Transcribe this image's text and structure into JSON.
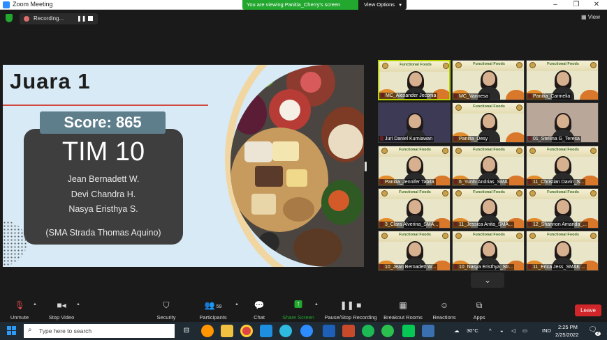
{
  "window": {
    "title": "Zoom Meeting"
  },
  "banner": {
    "text": "You are viewing Panitia_Cherry's screen",
    "options_label": "View Options"
  },
  "recording": {
    "label": "Recording..."
  },
  "view_label": "View",
  "slide": {
    "title": "Juara 1",
    "score": "Score: 865",
    "team": "TIM 10",
    "members": [
      "Jean Bernadett W.",
      "Devi Chandra H.",
      "Nasya Eristhya S."
    ],
    "school": "(SMA Strada Thomas Aquino)"
  },
  "tile_banner": "Functional Foods",
  "participants": [
    {
      "name": "MC_Alexander Jeconia",
      "style": "active"
    },
    {
      "name": "MC_Vannesa",
      "style": "std"
    },
    {
      "name": "Panitia_Carmelia",
      "style": "std"
    },
    {
      "name": "Juri Daniel Kurniawan",
      "style": "dark"
    },
    {
      "name": "Panitia_Desy",
      "style": "std"
    },
    {
      "name": "01_Stellina G_Teresa",
      "style": "room"
    },
    {
      "name": "Panitia_Jennifer Tabita",
      "style": "std"
    },
    {
      "name": "6_Yunhi Andrias_SMA",
      "style": "std"
    },
    {
      "name": "11_Christian Davin_S...",
      "style": "std"
    },
    {
      "name": "3_Clara Alverina_SMA...",
      "style": "std"
    },
    {
      "name": "11_Jessica Anita_SMA...",
      "style": "std"
    },
    {
      "name": "12_Shannon Amanda_...",
      "style": "std"
    },
    {
      "name": "10_Jean Bernadett W...",
      "style": "std"
    },
    {
      "name": "10_Nasya Eristhya_Str...",
      "style": "std"
    },
    {
      "name": "11_Erica Jess_SMAK ...",
      "style": "std"
    }
  ],
  "toolbar": {
    "unmute": "Unmute",
    "stop_video": "Stop Video",
    "security": "Security",
    "participants": "Participants",
    "participants_count": "59",
    "chat": "Chat",
    "share_screen": "Share Screen",
    "record": "Pause/Stop Recording",
    "breakout": "Breakout Rooms",
    "reactions": "Reactions",
    "apps": "Apps",
    "leave": "Leave"
  },
  "taskbar": {
    "search_placeholder": "Type here to search",
    "weather": "30°C",
    "lang": "IND",
    "time": "2:25 PM",
    "date": "2/25/2022",
    "notification_count": "2"
  },
  "colors": {
    "accent_green": "#23a82f",
    "leave_red": "#d0262a",
    "slide_bg": "#d7eaf6",
    "card": "#3e3e3e",
    "score_pill": "#5e7e8c"
  }
}
